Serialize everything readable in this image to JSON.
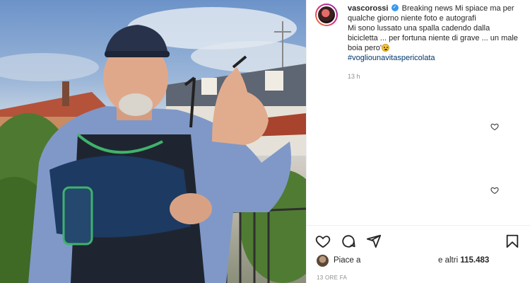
{
  "post": {
    "username": "vascorossi",
    "caption_line1": "Breaking news Mi spiace ma per qualche giorno niente foto e autografi",
    "caption_line2": "Mi sono lussato una spalla cadendo dalla bicicletta ... per fortuna niente di grave ... un male boia pero'",
    "hashtag": "#vogliounavitaspericolata",
    "caption_time": "13 h",
    "liked_by_prefix": "Piace a",
    "liked_by_suffix": "e altri",
    "likes_count": "115.483",
    "post_time": "13 ORE FA"
  },
  "icons": {
    "verified": "verified-badge-icon",
    "emoji": "smiling-face-emoji",
    "comment_like": "heart-outline-icon",
    "like": "heart-outline-icon",
    "comment": "comment-bubble-icon",
    "share": "paper-plane-icon",
    "save": "bookmark-icon"
  },
  "colors": {
    "text": "#262626",
    "secondary": "#8e8e8e",
    "hashtag": "#00376b",
    "verified": "#3897f0"
  }
}
